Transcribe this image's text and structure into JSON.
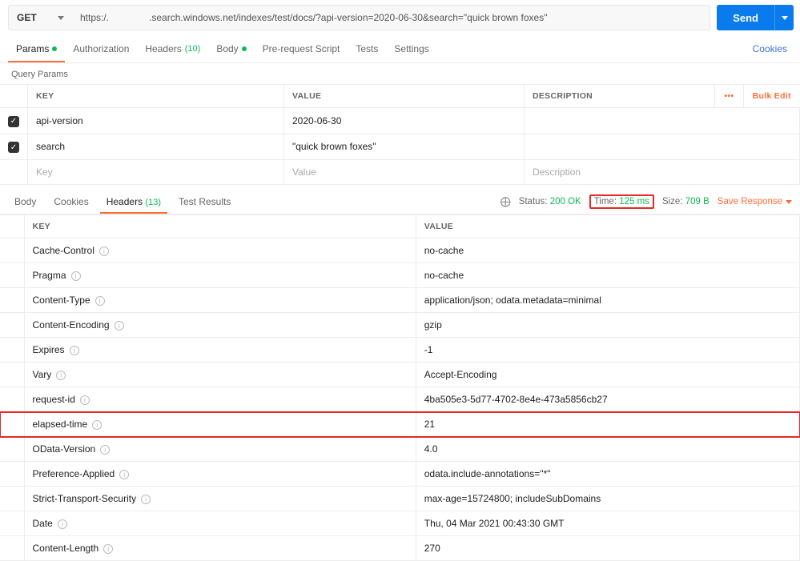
{
  "request": {
    "method": "GET",
    "url": "https:/.               .search.windows.net/indexes/test/docs/?api-version=2020-06-30&search=\"quick brown foxes\"",
    "send_label": "Send"
  },
  "tabs": {
    "params": {
      "label": "Params",
      "active": true,
      "dot": true
    },
    "authorization": {
      "label": "Authorization"
    },
    "headers": {
      "label": "Headers",
      "count": "(10)"
    },
    "body": {
      "label": "Body",
      "dot": true
    },
    "prerequest": {
      "label": "Pre-request Script"
    },
    "tests": {
      "label": "Tests"
    },
    "settings": {
      "label": "Settings"
    },
    "cookies": "Cookies"
  },
  "query_params": {
    "section_label": "Query Params",
    "header": {
      "key": "KEY",
      "value": "VALUE",
      "description": "DESCRIPTION",
      "more": "•••",
      "bulk": "Bulk Edit"
    },
    "rows": [
      {
        "checked": true,
        "key": "api-version",
        "value": "2020-06-30",
        "description": ""
      },
      {
        "checked": true,
        "key": "search",
        "value": "\"quick brown foxes\"",
        "description": ""
      }
    ],
    "placeholder": {
      "key": "Key",
      "value": "Value",
      "description": "Description"
    }
  },
  "response": {
    "tabs": {
      "body": "Body",
      "cookies": "Cookies",
      "headers": {
        "label": "Headers",
        "count": "(13)"
      },
      "test_results": "Test Results"
    },
    "status": {
      "status_label": "Status:",
      "status_value": "200 OK",
      "time_label": "Time:",
      "time_value": "125 ms",
      "size_label": "Size:",
      "size_value": "709 B",
      "save_response": "Save Response"
    },
    "headers_table": {
      "key": "KEY",
      "value": "VALUE",
      "rows": [
        {
          "key": "Cache-Control",
          "value": "no-cache"
        },
        {
          "key": "Pragma",
          "value": "no-cache"
        },
        {
          "key": "Content-Type",
          "value": "application/json; odata.metadata=minimal"
        },
        {
          "key": "Content-Encoding",
          "value": "gzip"
        },
        {
          "key": "Expires",
          "value": "-1"
        },
        {
          "key": "Vary",
          "value": "Accept-Encoding"
        },
        {
          "key": "request-id",
          "value": "4ba505e3-5d77-4702-8e4e-473a5856cb27"
        },
        {
          "key": "elapsed-time",
          "value": "21",
          "highlight": true
        },
        {
          "key": "OData-Version",
          "value": "4.0"
        },
        {
          "key": "Preference-Applied",
          "value": "odata.include-annotations=\"*\""
        },
        {
          "key": "Strict-Transport-Security",
          "value": "max-age=15724800; includeSubDomains"
        },
        {
          "key": "Date",
          "value": "Thu, 04 Mar 2021 00:43:30 GMT"
        },
        {
          "key": "Content-Length",
          "value": "270"
        }
      ]
    }
  }
}
